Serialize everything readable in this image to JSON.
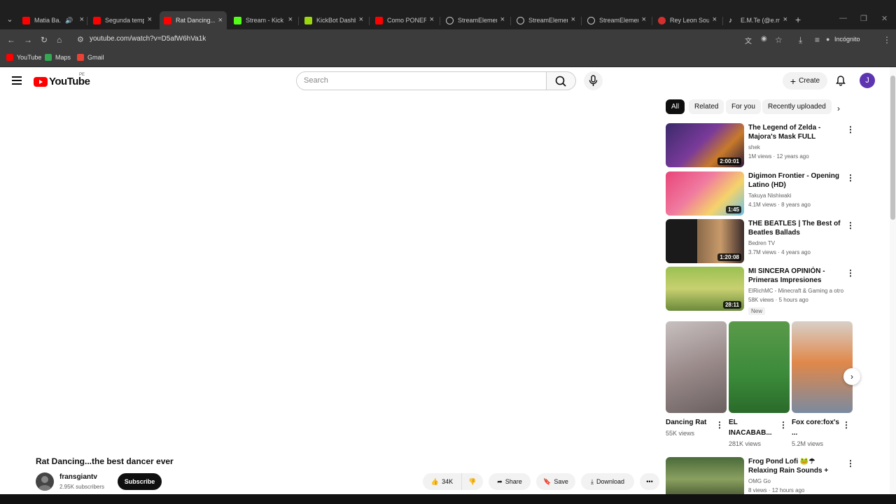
{
  "browser": {
    "tabs": [
      {
        "title": "Matia Ba...",
        "favicon": "youtube-icon",
        "color": "#ff0000",
        "audio": true
      },
      {
        "title": "Segunda temp",
        "favicon": "youtube-icon",
        "color": "#ff0000"
      },
      {
        "title": "Rat Dancing...th",
        "favicon": "youtube-icon",
        "color": "#ff0000",
        "active": true
      },
      {
        "title": "Stream - Kick",
        "favicon": "kick-icon",
        "color": "#53fc18"
      },
      {
        "title": "KickBot Dashb",
        "favicon": "kickbot-icon",
        "color": "#9bd70f"
      },
      {
        "title": "Como PONER",
        "favicon": "youtube-icon",
        "color": "#ff0000"
      },
      {
        "title": "StreamElement",
        "favicon": "streamelements-icon",
        "color": "#c4c7c5"
      },
      {
        "title": "StreamElement",
        "favicon": "streamelements-icon",
        "color": "#c4c7c5"
      },
      {
        "title": "StreamElemen",
        "favicon": "streamelements-icon",
        "color": "#c4c7c5"
      },
      {
        "title": "Rey Leon Sour",
        "favicon": "music-icon",
        "color": "#d32f2f"
      },
      {
        "title": "E.M.Te (@e.m",
        "favicon": "tiktok-icon",
        "color": "#ffffff"
      }
    ],
    "url": "youtube.com/watch?v=D5afW6hVa1k",
    "incognito_label": "Incógnito",
    "bookmarks": [
      {
        "label": "YouTube",
        "icon": "youtube-icon",
        "color": "#ff0000"
      },
      {
        "label": "Maps",
        "icon": "maps-icon",
        "color": "#34a853"
      },
      {
        "label": "Gmail",
        "icon": "gmail-icon",
        "color": "#ea4335"
      }
    ]
  },
  "header": {
    "logo_text": "YouTube",
    "country": "PE",
    "search_placeholder": "Search",
    "create_label": "Create",
    "avatar_letter": "J"
  },
  "chips": [
    "All",
    "Related",
    "For you",
    "Recently uploaded"
  ],
  "recommendations": [
    {
      "title": "The Legend of Zelda - Majora's Mask FULL SOUNDTRACK",
      "channel": "shek",
      "meta": "1M views · 12 years ago",
      "duration": "2:00:01"
    },
    {
      "title": "Digimon Frontier - Opening Latino (HD)",
      "channel": "Takuya Nishiwaki",
      "meta": "4.1M views · 8 years ago",
      "duration": "1:45"
    },
    {
      "title": "THE BEATLES | The Best of Beatles Ballads",
      "channel": "Bedren TV",
      "meta": "3.7M views · 4 years ago",
      "duration": "1:20:08"
    },
    {
      "title": "MI SINCERA OPINIÓN - Primeras Impresiones Minecra...",
      "channel": "ElRichMC - Minecraft & Gaming a otro ni...",
      "meta": "58K views · 5 hours ago",
      "duration": "28:11",
      "badge": "New"
    },
    {
      "title": "Frog Pond Lofi 🐸☂ Relaxing Rain Sounds + Chill Beats",
      "channel": "OMG Go",
      "meta": "8 views · 12 hours ago",
      "duration": ""
    }
  ],
  "shorts": [
    {
      "title": "Dancing Rat",
      "views": "55K views"
    },
    {
      "title": "EL INACABAB...",
      "views": "281K views"
    },
    {
      "title": "Fox core:fox's ...",
      "views": "5.2M views"
    }
  ],
  "video": {
    "title": "Rat Dancing...the best dancer ever",
    "channel": "fransgiantv",
    "subscribers": "2.95K subscribers",
    "subscribe_label": "Subscribe",
    "likes": "34K",
    "share_label": "Share",
    "save_label": "Save",
    "download_label": "Download"
  }
}
